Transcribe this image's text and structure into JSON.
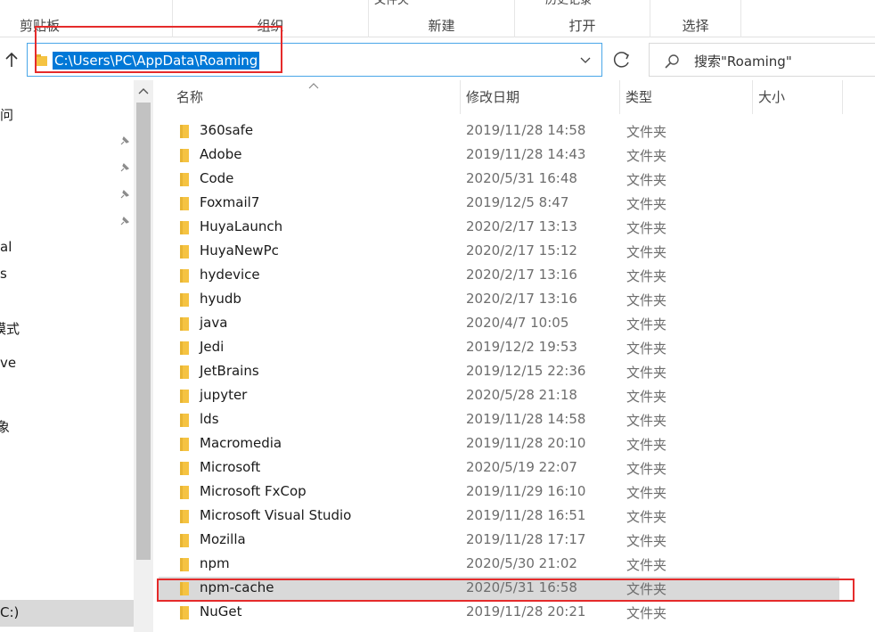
{
  "ribbon": {
    "groups": [
      {
        "label": "剪贴板",
        "cut_text": ""
      },
      {
        "label": "组织",
        "cut_text": ""
      },
      {
        "label": "新建",
        "cut_text": "文件夹"
      },
      {
        "label": "打开",
        "cut_text": "历史记录"
      },
      {
        "label": "选择",
        "cut_text": ""
      }
    ]
  },
  "address": {
    "path": "C:\\Users\\PC\\AppData\\Roaming",
    "search_placeholder": "搜索\"Roaming\""
  },
  "nav": {
    "items": [
      "问",
      "al",
      "s",
      "模式",
      "ve",
      "象",
      "C:)"
    ],
    "pinned_count": 4
  },
  "columns": {
    "name": "名称",
    "date": "修改日期",
    "type": "类型",
    "size": "大小"
  },
  "files": [
    {
      "name": "360safe",
      "date": "2019/11/28 14:58",
      "type": "文件夹"
    },
    {
      "name": "Adobe",
      "date": "2019/11/28 14:43",
      "type": "文件夹"
    },
    {
      "name": "Code",
      "date": "2020/5/31 16:48",
      "type": "文件夹"
    },
    {
      "name": "Foxmail7",
      "date": "2019/12/5 8:47",
      "type": "文件夹"
    },
    {
      "name": "HuyaLaunch",
      "date": "2020/2/17 13:13",
      "type": "文件夹"
    },
    {
      "name": "HuyaNewPc",
      "date": "2020/2/17 15:12",
      "type": "文件夹"
    },
    {
      "name": "hydevice",
      "date": "2020/2/17 13:16",
      "type": "文件夹"
    },
    {
      "name": "hyudb",
      "date": "2020/2/17 13:16",
      "type": "文件夹"
    },
    {
      "name": "java",
      "date": "2020/4/7 10:05",
      "type": "文件夹"
    },
    {
      "name": "Jedi",
      "date": "2019/12/2 19:53",
      "type": "文件夹"
    },
    {
      "name": "JetBrains",
      "date": "2019/12/15 22:36",
      "type": "文件夹"
    },
    {
      "name": "jupyter",
      "date": "2020/5/28 21:18",
      "type": "文件夹"
    },
    {
      "name": "lds",
      "date": "2019/11/28 14:58",
      "type": "文件夹"
    },
    {
      "name": "Macromedia",
      "date": "2019/11/28 20:10",
      "type": "文件夹"
    },
    {
      "name": "Microsoft",
      "date": "2020/5/19 22:07",
      "type": "文件夹"
    },
    {
      "name": "Microsoft FxCop",
      "date": "2019/11/29 16:10",
      "type": "文件夹"
    },
    {
      "name": "Microsoft Visual Studio",
      "date": "2019/11/28 16:51",
      "type": "文件夹"
    },
    {
      "name": "Mozilla",
      "date": "2019/11/28 17:17",
      "type": "文件夹"
    },
    {
      "name": "npm",
      "date": "2020/5/30 21:02",
      "type": "文件夹"
    },
    {
      "name": "npm-cache",
      "date": "2020/5/31 16:58",
      "type": "文件夹",
      "selected": true
    },
    {
      "name": "NuGet",
      "date": "2019/11/28 20:21",
      "type": "文件夹"
    }
  ],
  "colors": {
    "accent": "#0078d7",
    "folder": "#f5c342",
    "annotation": "#e52b2b",
    "selection": "#d9d9d9"
  },
  "icons": [
    "up-arrow-icon",
    "folder-icon",
    "chevron-down-icon",
    "refresh-icon",
    "search-icon",
    "pin-icon",
    "sort-up-icon"
  ]
}
